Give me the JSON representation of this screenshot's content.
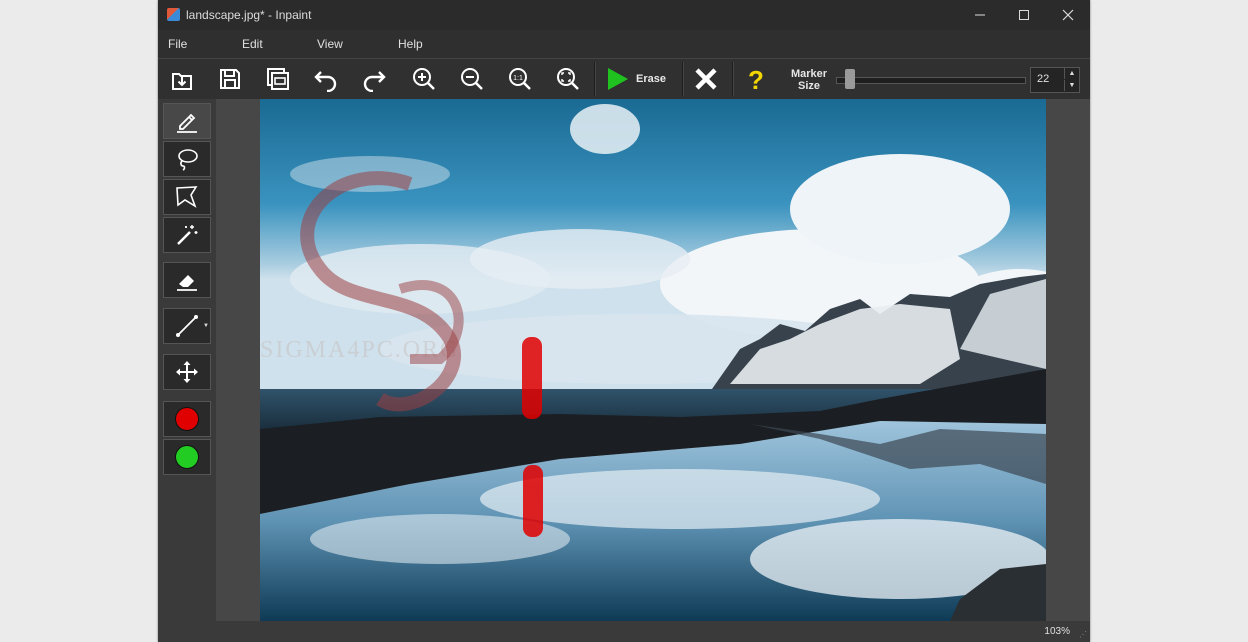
{
  "window": {
    "title": "landscape.jpg* - Inpaint",
    "controls": [
      "minimize-icon",
      "maximize-icon",
      "close-icon"
    ]
  },
  "menu": [
    "File",
    "Edit",
    "View",
    "Help"
  ],
  "toolbar": {
    "buttons": [
      "open-icon",
      "save-icon",
      "save-copy-icon",
      "undo-icon",
      "redo-icon",
      "zoom-in-icon",
      "zoom-out-icon",
      "zoom-actual-icon",
      "zoom-fit-icon"
    ],
    "erase_label": "Erase",
    "marker_label_line1": "Marker",
    "marker_label_line2": "Size",
    "marker_size": "22",
    "marker_fraction": 0.05
  },
  "tools": [
    "marker-icon",
    "lasso-icon",
    "polygonal-lasso-icon",
    "magic-wand-icon",
    "eraser-icon",
    "line-icon",
    "move-icon"
  ],
  "colors": {
    "red_marker": "#e00000",
    "green_marker": "#22cc22",
    "play": "#1fc21f",
    "help": "#f2d600"
  },
  "status": {
    "zoom": "103%"
  },
  "watermark": "SIGMA4PC.ORG"
}
